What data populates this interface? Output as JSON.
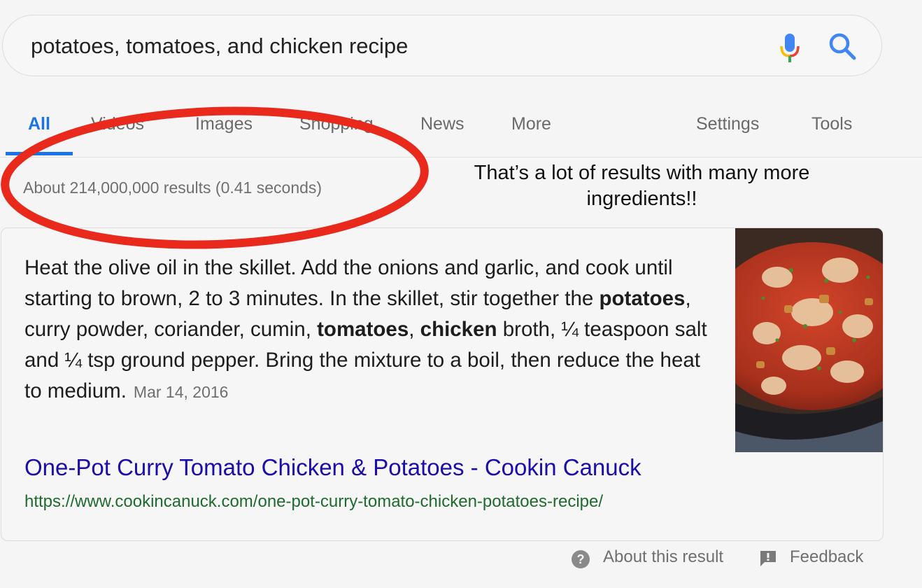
{
  "search": {
    "query": "potatoes, tomatoes, and chicken recipe",
    "mic_icon": "microphone-icon",
    "search_icon": "magnifier-icon"
  },
  "tabs": [
    {
      "label": "All",
      "active": true
    },
    {
      "label": "Videos",
      "active": false
    },
    {
      "label": "Images",
      "active": false
    },
    {
      "label": "Shopping",
      "active": false
    },
    {
      "label": "News",
      "active": false
    },
    {
      "label": "More",
      "active": false
    }
  ],
  "tools": {
    "settings_label": "Settings",
    "tools_label": "Tools"
  },
  "result_stats": "About 214,000,000 results (0.41 seconds)",
  "annotation": {
    "text": "That’s a lot of results with many more ingredients!!",
    "ellipse_color": "#e8291c"
  },
  "snippet": {
    "segments": [
      {
        "text": "Heat the olive oil in the skillet. Add the onions and garlic, and cook until starting to brown, 2 to 3 minutes. In the skillet, stir together the ",
        "bold": false
      },
      {
        "text": "potatoes",
        "bold": true
      },
      {
        "text": ", curry powder, coriander, cumin, ",
        "bold": false
      },
      {
        "text": "tomatoes",
        "bold": true
      },
      {
        "text": ", ",
        "bold": false
      },
      {
        "text": "chicken",
        "bold": true
      },
      {
        "text": " broth, ¼ teaspoon salt and ¼ tsp ground pepper. Bring the mixture to a boil, then reduce the heat to medium.",
        "bold": false
      }
    ],
    "date": "Mar 14, 2016",
    "image_alt": "curry tomato chicken and potatoes in skillet",
    "title": "One-Pot Curry Tomato Chicken & Potatoes - Cookin Canuck",
    "url": "https://www.cookincanuck.com/one-pot-curry-tomato-chicken-potatoes-recipe/"
  },
  "footer": {
    "about_label": "About this result",
    "feedback_label": "Feedback"
  },
  "colors": {
    "link": "#1a0dab",
    "url": "#1e6b2e",
    "active_tab": "#1a73e8",
    "muted": "#6f6f6f"
  }
}
